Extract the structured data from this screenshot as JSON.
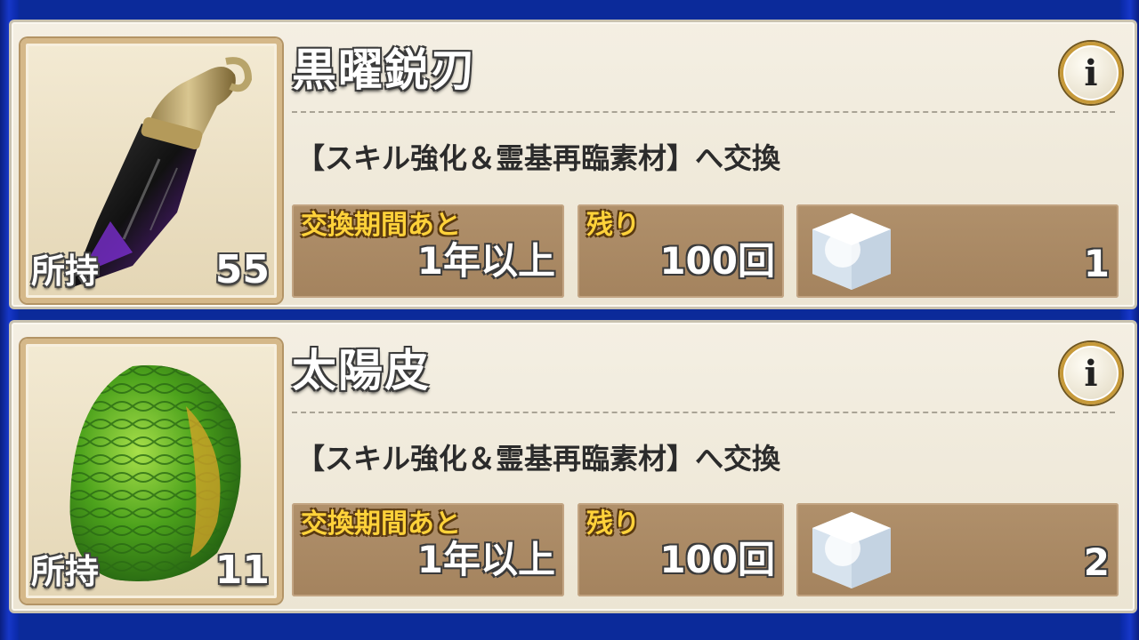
{
  "items": [
    {
      "name": "黒曜鋭刃",
      "held_label": "所持",
      "held_count": "55",
      "description": "【スキル強化＆霊基再臨素材】へ交換",
      "period_label": "交換期間あと",
      "period_value": "1年以上",
      "remaining_label": "残り",
      "remaining_value": "100回",
      "cost_value": "1",
      "icon": "obsidian-blade-icon"
    },
    {
      "name": "太陽皮",
      "held_label": "所持",
      "held_count": "11",
      "description": "【スキル強化＆霊基再臨素材】へ交換",
      "period_label": "交換期間あと",
      "period_value": "1年以上",
      "remaining_label": "残り",
      "remaining_value": "100回",
      "cost_value": "2",
      "icon": "sun-hide-icon"
    }
  ],
  "info_glyph": "i",
  "colors": {
    "background": "#0b2a9a",
    "card": "#f4efe3",
    "box": "#a4835e",
    "caption": "#ffd23a"
  }
}
